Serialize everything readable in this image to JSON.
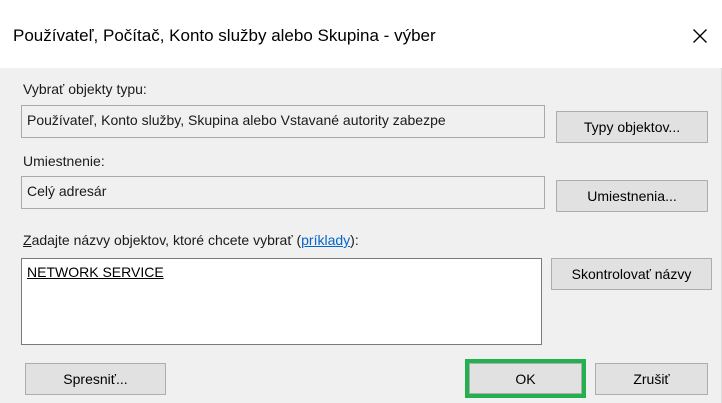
{
  "window": {
    "title": "Používateľ, Počítač, Konto služby alebo Skupina - výber",
    "close_glyph": "✕"
  },
  "object_types": {
    "label": "Vybrať objekty typu:",
    "value": "Používateľ, Konto služby, Skupina alebo Vstavané autority zabezpe",
    "button": "Typy objektov..."
  },
  "location": {
    "label": "Umiestnenie:",
    "value": "Celý adresár",
    "button": "Umiestnenia..."
  },
  "names": {
    "label_first_letter": "Z",
    "label_rest": "adajte názvy objektov, ktoré chcete vybrať (",
    "examples_link": "príklady",
    "label_close": "):",
    "entered_value": "NETWORK SERVICE",
    "check_button": "Skontrolovať názvy"
  },
  "footer": {
    "advanced_button": "Spresniť...",
    "ok_button": "OK",
    "cancel_button": "Zrušiť"
  },
  "colors": {
    "highlight": "#22b14c",
    "link": "#0066cc"
  }
}
